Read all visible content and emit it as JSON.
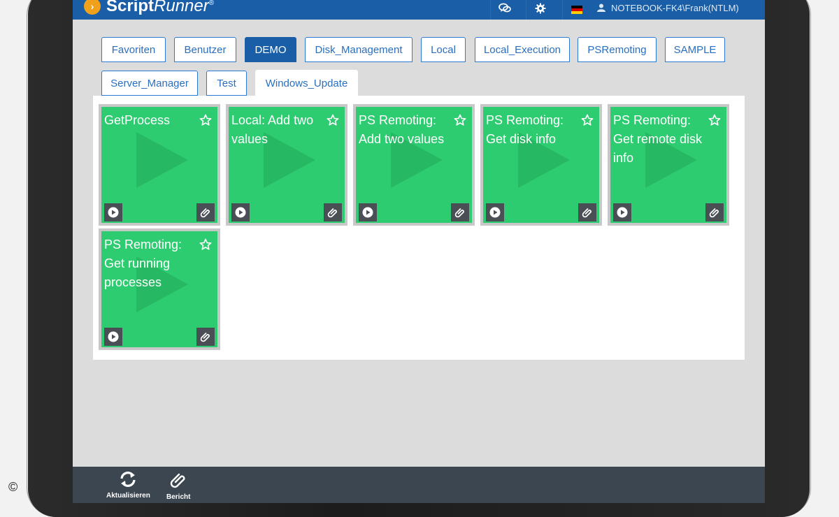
{
  "app": {
    "logo_a": "Script",
    "logo_b": "Runner",
    "logo_reg": "®",
    "user": "NOTEBOOK-FK4\\Frank(NTLM)"
  },
  "colors": {
    "header": "#1a5ea7",
    "tile": "#2ecc71",
    "footer": "#3c4650",
    "accent": "#f0a11c"
  },
  "header_icons": [
    "chat-icon",
    "gear-icon",
    "german-flag-icon",
    "user-icon"
  ],
  "tabs": [
    {
      "label": "Favoriten",
      "active": false
    },
    {
      "label": "Benutzer",
      "active": false
    },
    {
      "label": "DEMO",
      "active": true
    },
    {
      "label": "Disk_Management",
      "active": false
    },
    {
      "label": "Local",
      "active": false
    },
    {
      "label": "Local_Execution",
      "active": false
    },
    {
      "label": "PSRemoting",
      "active": false
    },
    {
      "label": "SAMPLE",
      "active": false
    },
    {
      "label": "Server_Manager",
      "active": false
    },
    {
      "label": "Test",
      "active": false
    },
    {
      "label": "Windows_Update",
      "active": false
    }
  ],
  "tiles": [
    {
      "title": "GetProcess"
    },
    {
      "title": "Local: Add two values"
    },
    {
      "title": "PS Remoting: Add two values"
    },
    {
      "title": "PS Remoting: Get disk info"
    },
    {
      "title": "PS Remoting: Get remote disk info"
    },
    {
      "title": "PS Remoting: Get running processes"
    }
  ],
  "footer": {
    "refresh_label": "Aktualisieren",
    "report_label": "Bericht"
  },
  "copyright": "©"
}
